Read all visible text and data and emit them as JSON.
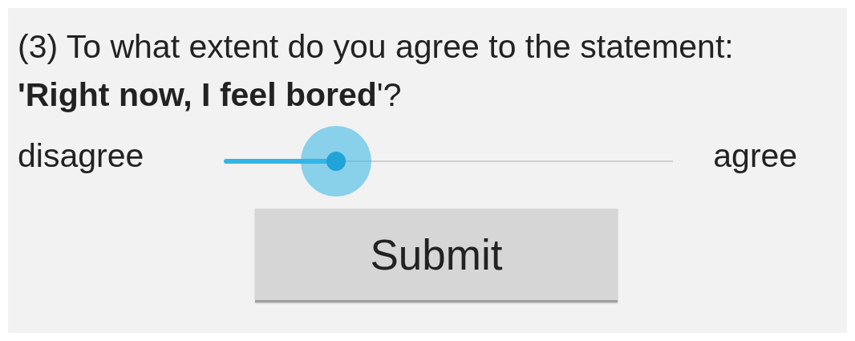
{
  "question": {
    "prompt": "(3) To what extent do you agree to the statement:",
    "statement": "**'Right now, I feel bored**'?"
  },
  "slider": {
    "min_label": "disagree",
    "max_label": "agree",
    "level": 0.25
  },
  "buttons": [
    {
      "kind": "submit",
      "label": "Submit"
    }
  ]
}
